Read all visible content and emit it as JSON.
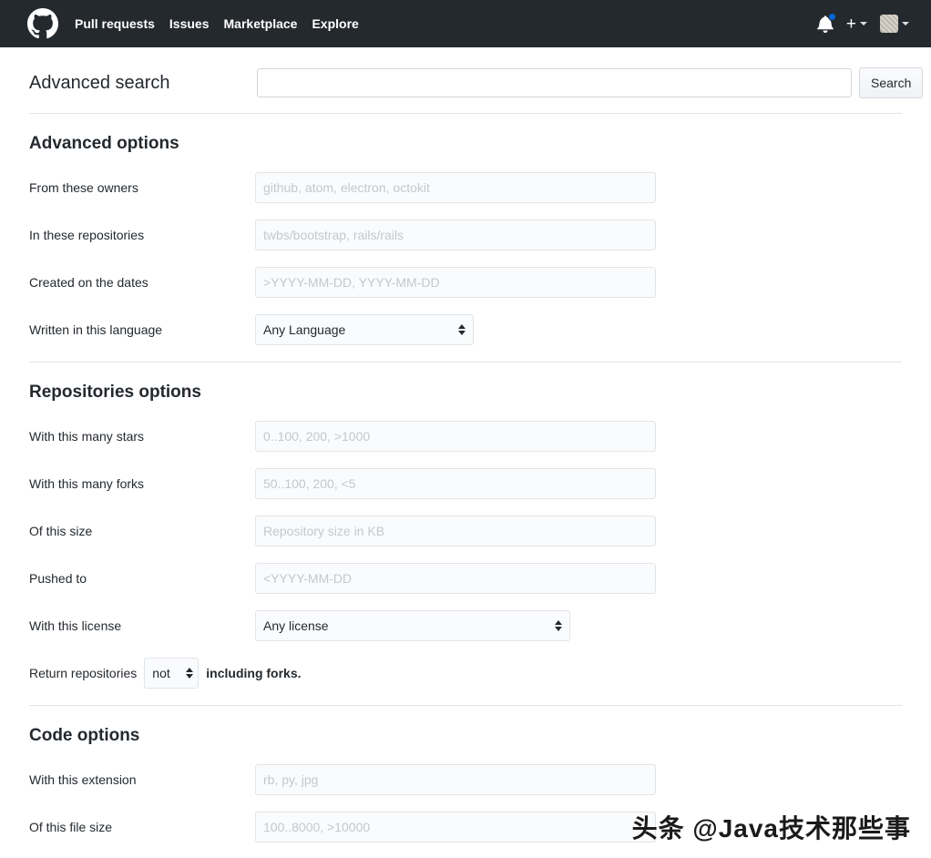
{
  "header": {
    "logo_icon": "github-octocat-icon",
    "nav": [
      {
        "label": "Pull requests"
      },
      {
        "label": "Issues"
      },
      {
        "label": "Marketplace"
      },
      {
        "label": "Explore"
      }
    ],
    "notifications_icon": "bell-icon",
    "has_unread": true,
    "create_new_icon": "plus-icon",
    "avatar_icon": "avatar-icon",
    "background_color": "#24292e",
    "unread_dot_color": "#0366d6"
  },
  "search": {
    "title": "Advanced search",
    "query_value": "",
    "query_placeholder": "",
    "button_label": "Search"
  },
  "advanced_options": {
    "title": "Advanced options",
    "fields": [
      {
        "label": "From these owners",
        "placeholder": "github, atom, electron, octokit",
        "value": "",
        "type": "text"
      },
      {
        "label": "In these repositories",
        "placeholder": "twbs/bootstrap, rails/rails",
        "value": "",
        "type": "text"
      },
      {
        "label": "Created on the dates",
        "placeholder": ">YYYY-MM-DD, YYYY-MM-DD",
        "value": "",
        "type": "text"
      }
    ],
    "language": {
      "label": "Written in this language",
      "selected": "Any Language"
    }
  },
  "repositories_options": {
    "title": "Repositories options",
    "fields": [
      {
        "label": "With this many stars",
        "placeholder": "0..100, 200, >1000",
        "value": "",
        "type": "text"
      },
      {
        "label": "With this many forks",
        "placeholder": "50..100, 200, <5",
        "value": "",
        "type": "text"
      },
      {
        "label": "Of this size",
        "placeholder": "Repository size in KB",
        "value": "",
        "type": "text"
      },
      {
        "label": "Pushed to",
        "placeholder": "<YYYY-MM-DD",
        "value": "",
        "type": "text"
      }
    ],
    "license": {
      "label": "With this license",
      "selected": "Any license"
    },
    "forks": {
      "lead_text": "Return repositories",
      "selected": "not",
      "trail_text": "including forks."
    }
  },
  "code_options": {
    "title": "Code options",
    "fields": [
      {
        "label": "With this extension",
        "placeholder": "rb, py, jpg",
        "value": "",
        "type": "text"
      },
      {
        "label": "Of this file size",
        "placeholder": "100..8000, >10000",
        "value": "",
        "type": "text"
      }
    ]
  },
  "watermark": {
    "text": "头条 @Java技术那些事"
  }
}
